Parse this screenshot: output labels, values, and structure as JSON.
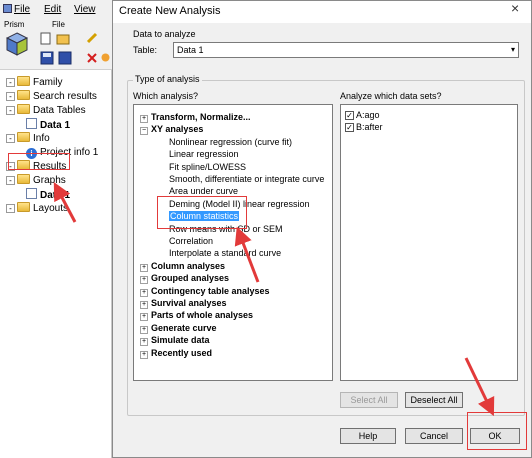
{
  "app": {
    "menu": {
      "file": "File",
      "edit": "Edit",
      "view": "View"
    },
    "toolbar_groups": {
      "prism": "Prism",
      "file": "File"
    },
    "navigator": [
      {
        "label": "Family",
        "indent": 0,
        "icon": "folder"
      },
      {
        "label": "Search results",
        "indent": 0,
        "icon": "folder"
      },
      {
        "label": "Data Tables",
        "indent": 0,
        "icon": "folder"
      },
      {
        "label": "Data 1",
        "indent": 1,
        "icon": "sheet",
        "bold": true
      },
      {
        "label": "Info",
        "indent": 0,
        "icon": "folder"
      },
      {
        "label": "Project info 1",
        "indent": 1,
        "icon": "info"
      },
      {
        "label": "Results",
        "indent": 0,
        "icon": "folder"
      },
      {
        "label": "Graphs",
        "indent": 0,
        "icon": "folder"
      },
      {
        "label": "Data 1",
        "indent": 1,
        "icon": "sheet",
        "bold": true
      },
      {
        "label": "Layouts",
        "indent": 0,
        "icon": "folder"
      }
    ]
  },
  "dialog": {
    "title": "Create New Analysis",
    "data_group_label": "Data to analyze",
    "table_label": "Table:",
    "table_value": "Data 1",
    "type_group_label": "Type of analysis",
    "which_analysis_label": "Which analysis?",
    "which_datasets_label": "Analyze which data sets?",
    "analyses": [
      {
        "label": "Transform, Normalize...",
        "category": true,
        "expanded": false
      },
      {
        "label": "XY analyses",
        "category": true,
        "expanded": true
      },
      {
        "label": "Nonlinear regression (curve fit)"
      },
      {
        "label": "Linear regression"
      },
      {
        "label": "Fit spline/LOWESS"
      },
      {
        "label": "Smooth, differentiate or integrate curve"
      },
      {
        "label": "Area under curve"
      },
      {
        "label": "Deming (Model II) linear regression"
      },
      {
        "label": "Column statistics",
        "selected": true
      },
      {
        "label": "Row means with SD or SEM"
      },
      {
        "label": "Correlation"
      },
      {
        "label": "Interpolate a standard curve"
      },
      {
        "label": "Column analyses",
        "category": true,
        "expanded": false
      },
      {
        "label": "Grouped analyses",
        "category": true,
        "expanded": false
      },
      {
        "label": "Contingency table analyses",
        "category": true,
        "expanded": false
      },
      {
        "label": "Survival analyses",
        "category": true,
        "expanded": false
      },
      {
        "label": "Parts of whole analyses",
        "category": true,
        "expanded": false
      },
      {
        "label": "Generate curve",
        "category": true,
        "expanded": false
      },
      {
        "label": "Simulate data",
        "category": true,
        "expanded": false
      },
      {
        "label": "Recently used",
        "category": true,
        "expanded": false
      }
    ],
    "datasets": [
      {
        "label": "A:ago",
        "checked": true
      },
      {
        "label": "B:after",
        "checked": true
      }
    ],
    "buttons": {
      "select_all": "Select All",
      "deselect_all": "Deselect All",
      "help": "Help",
      "cancel": "Cancel",
      "ok": "OK"
    },
    "close_glyph": "×"
  },
  "annotation_color": "#e23a3a"
}
